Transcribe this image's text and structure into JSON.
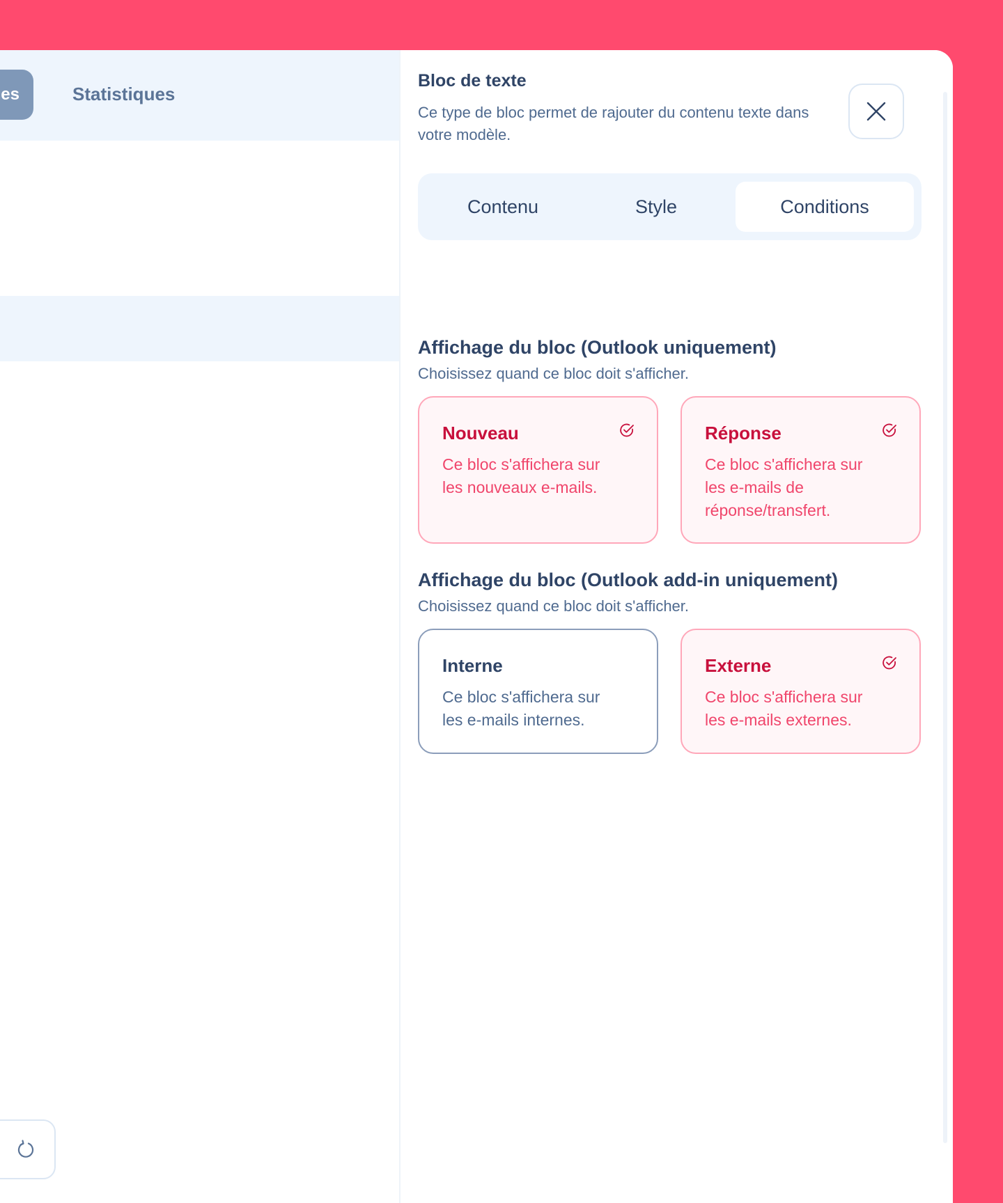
{
  "nav": {
    "active_tab_label": "es",
    "stats_tab_label": "Statistiques"
  },
  "panel": {
    "title": "Bloc de texte",
    "description": "Ce type de bloc permet de rajouter du contenu texte dans votre modèle.",
    "tabs": [
      {
        "label": "Contenu",
        "active": false
      },
      {
        "label": "Style",
        "active": false
      },
      {
        "label": "Conditions",
        "active": true
      }
    ],
    "sections": [
      {
        "title": "Affichage du bloc (Outlook uniquement)",
        "subtitle": "Choisissez quand ce bloc doit s'afficher.",
        "cards": [
          {
            "title": "Nouveau",
            "desc": "Ce bloc s'affichera sur les nouveaux e-mails.",
            "selected": true
          },
          {
            "title": "Réponse",
            "desc": "Ce bloc s'affichera sur les e-mails de réponse/transfert.",
            "selected": true
          }
        ]
      },
      {
        "title": "Affichage du bloc (Outlook add-in uniquement)",
        "subtitle": "Choisissez quand ce bloc doit s'afficher.",
        "cards": [
          {
            "title": "Interne",
            "desc": "Ce bloc s'affichera sur les e-mails internes.",
            "selected": false
          },
          {
            "title": "Externe",
            "desc": "Ce bloc s'affichera sur les e-mails externes.",
            "selected": true
          }
        ]
      }
    ]
  },
  "icons": {
    "close": "close-icon",
    "check": "check-circle-icon",
    "refresh": "refresh-icon"
  },
  "colors": {
    "background": "#ff4a6e",
    "selected_border": "#ffa7b9",
    "selected_title": "#c8103c",
    "selected_text": "#f0456b",
    "text_dark": "#2f4466",
    "text_muted": "#4f6a8f"
  }
}
